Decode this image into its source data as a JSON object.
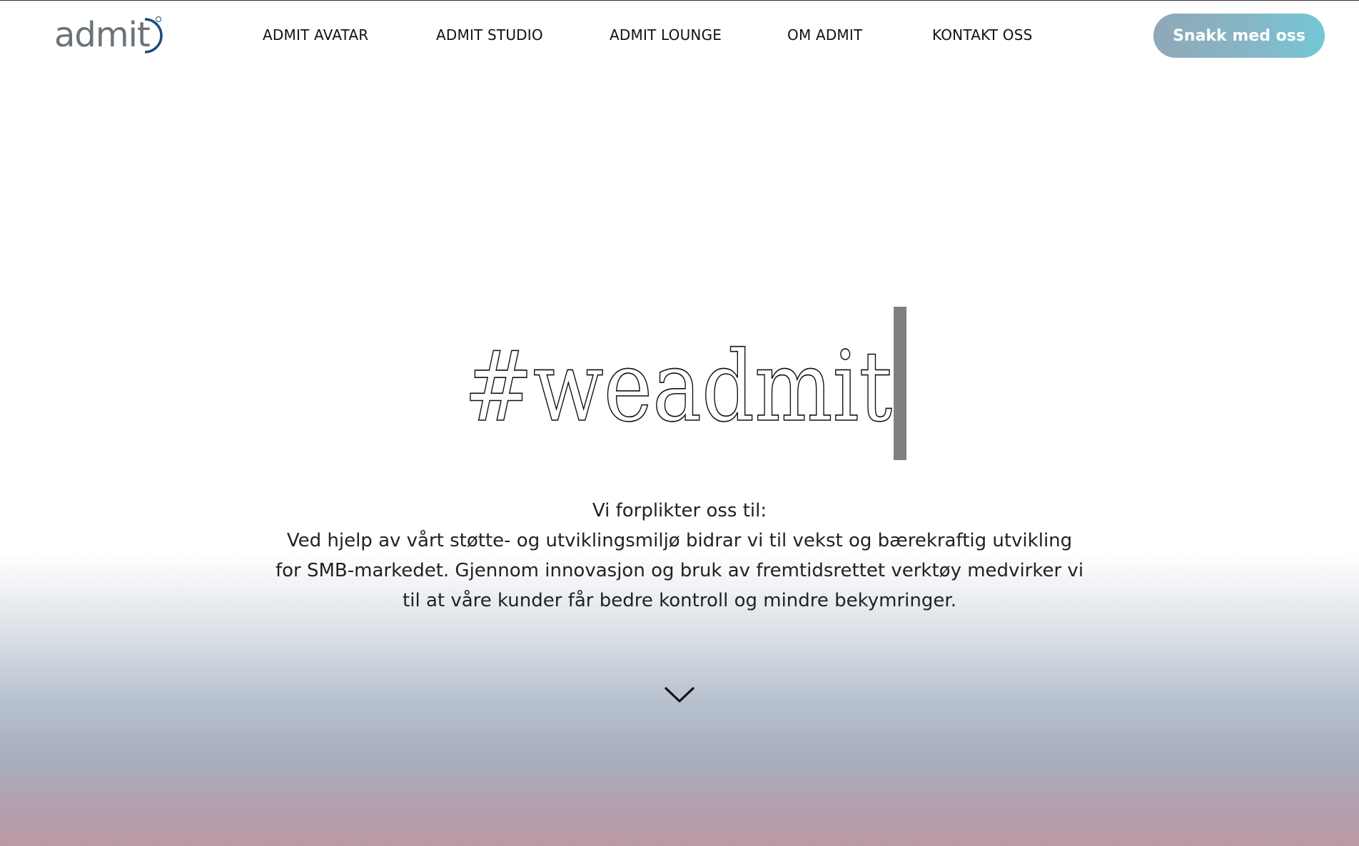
{
  "header": {
    "logo_text": "admit",
    "nav": [
      {
        "label": "ADMIT AVATAR"
      },
      {
        "label": "ADMIT STUDIO"
      },
      {
        "label": "ADMIT LOUNGE"
      },
      {
        "label": "OM ADMIT"
      },
      {
        "label": "KONTAKT OSS"
      }
    ],
    "cta_label": "Snakk med oss"
  },
  "hero": {
    "title": "#weadmit",
    "tagline": "Vi forplikter oss til:",
    "description_lines": [
      "Ved hjelp av vårt støtte- og utviklingsmiljø bidrar vi til vekst og bærekraftig utvikling",
      "for SMB-markedet. Gjennom innovasjon og bruk av fremtidsrettet verktøy medvirker vi",
      "til at våre kunder får bedre kontroll og mindre bekymringer."
    ]
  },
  "icons": {
    "logo": "admit-logo",
    "scroll": "chevron-down-icon"
  },
  "colors": {
    "cta_gradient_start": "#8fa8b8",
    "cta_gradient_end": "#73c6d6",
    "logo_gray": "#6b7378",
    "logo_blue": "#1f4d7a",
    "text": "#222222"
  }
}
